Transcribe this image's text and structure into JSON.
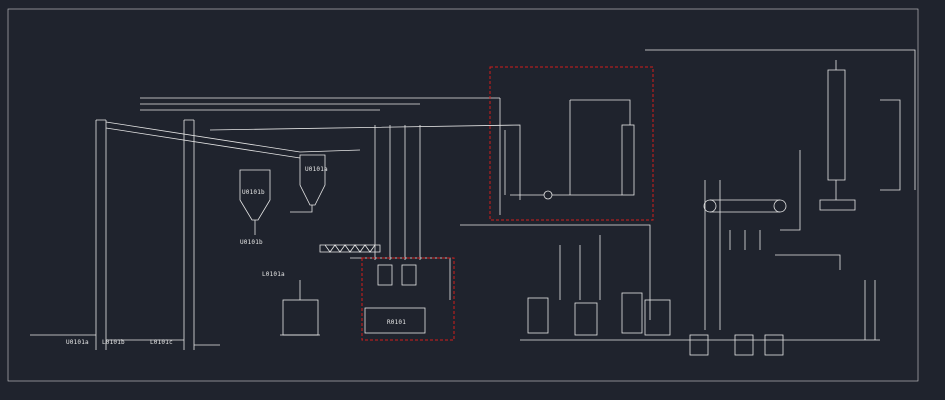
{
  "drawing": {
    "background": "#1f232d",
    "line_color": "#e6e6e6",
    "highlight_color": "#d01c1c"
  },
  "equipment_tags": {
    "hopper_left": "U0101a",
    "hopper_mid": "L0101b",
    "hopper_right": "L0101c",
    "cyclone_left": "U0101b",
    "cyclone_right": "U0101a",
    "reactor": "R0101",
    "conveyor_a": "U0101b",
    "conveyor_b": "L0101a"
  }
}
